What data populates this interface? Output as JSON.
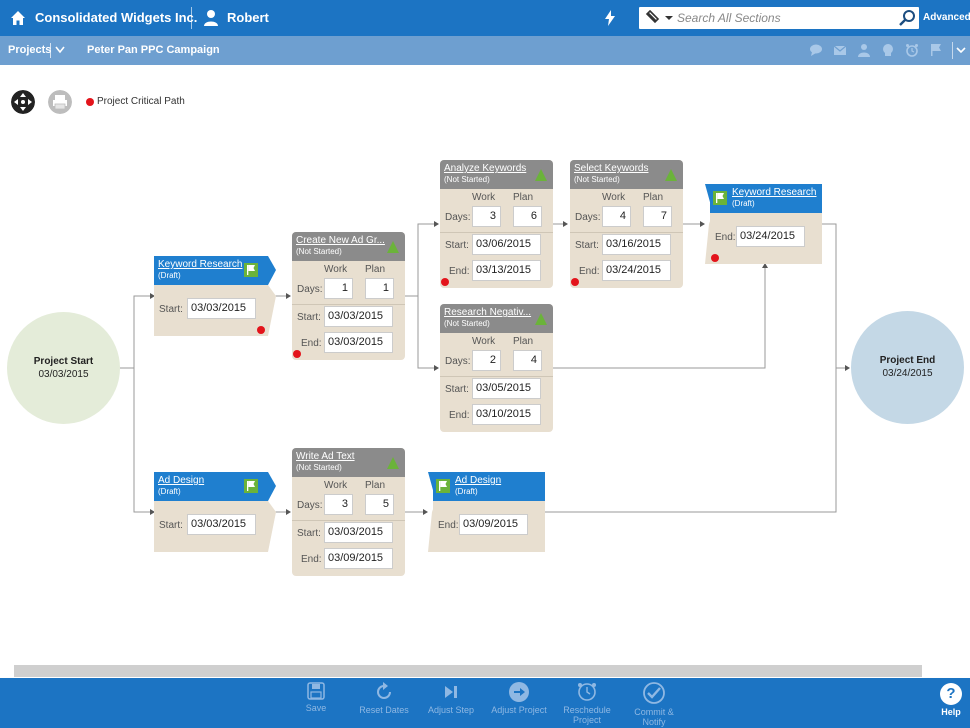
{
  "topbar": {
    "company": "Consolidated Widgets Inc.",
    "user": "Robert",
    "search_placeholder": "Search All Sections",
    "advanced": "Advanced"
  },
  "subbar": {
    "projects": "Projects",
    "campaign": "Peter Pan PPC Campaign",
    "icons": [
      "chat-icon",
      "mail-icon",
      "people-icon",
      "support-icon",
      "alarm-icon",
      "flag-icon",
      "chevron-down-icon"
    ]
  },
  "legend": {
    "critical_path": "Project Critical Path"
  },
  "milestones": {
    "start": {
      "title": "Project Start",
      "date": "03/03/2015"
    },
    "end": {
      "title": "Project End",
      "date": "03/24/2015"
    }
  },
  "labels": {
    "work": "Work",
    "plan": "Plan",
    "days": "Days:",
    "start": "Start:",
    "end": "End:"
  },
  "cards": {
    "kr1": {
      "name": "Keyword Research",
      "state": "(Draft)",
      "start": "03/03/2015"
    },
    "ad1": {
      "name": "Ad Design",
      "state": "(Draft)",
      "start": "03/03/2015"
    },
    "cnag": {
      "name": "Create New Ad Gr...",
      "state": "(Not Started)",
      "work": "1",
      "plan": "1",
      "start": "03/03/2015",
      "end": "03/03/2015"
    },
    "wat": {
      "name": "Write Ad Text",
      "state": "(Not Started)",
      "work": "3",
      "plan": "5",
      "start": "03/03/2015",
      "end": "03/09/2015"
    },
    "ak": {
      "name": "Analyze Keywords",
      "state": "(Not Started)",
      "work": "3",
      "plan": "6",
      "start": "03/06/2015",
      "end": "03/13/2015"
    },
    "rn": {
      "name": "Research Negativ...",
      "state": "(Not Started)",
      "work": "2",
      "plan": "4",
      "start": "03/05/2015",
      "end": "03/10/2015"
    },
    "sk": {
      "name": "Select Keywords",
      "state": "(Not Started)",
      "work": "4",
      "plan": "7",
      "start": "03/16/2015",
      "end": "03/24/2015"
    },
    "kr2": {
      "name": "Keyword Research",
      "state": "(Draft)",
      "end": "03/24/2015"
    },
    "ad2": {
      "name": "Ad Design",
      "state": "(Draft)",
      "end": "03/09/2015"
    }
  },
  "bottom": {
    "save": "Save",
    "reset": "Reset Dates",
    "adjust_step": "Adjust Step",
    "adjust_project": "Adjust Project",
    "reschedule": "Reschedule Project",
    "commit": "Commit & Notify",
    "help": "Help"
  }
}
